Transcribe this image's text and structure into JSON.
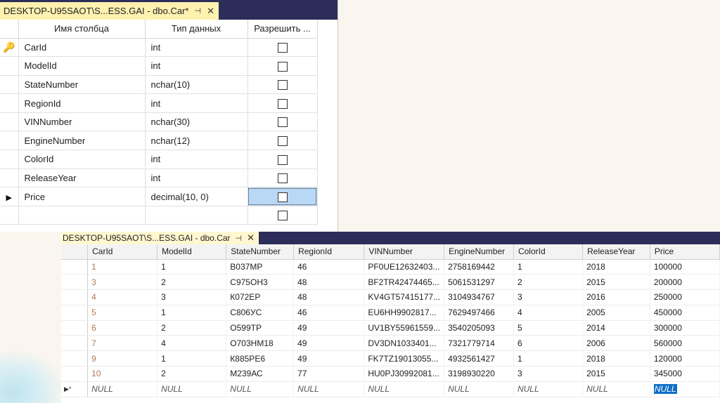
{
  "designer": {
    "tab_title": "DESKTOP-U95SAOT\\S...ESS.GAI - dbo.Car*",
    "pin_glyph": "⊣",
    "close_glyph": "✕",
    "columns": [
      "Имя столбца",
      "Тип данных",
      "Разрешить ..."
    ],
    "rows": [
      {
        "name": "CarId",
        "type": "int",
        "key": true
      },
      {
        "name": "ModelId",
        "type": "int"
      },
      {
        "name": "StateNumber",
        "type": "nchar(10)"
      },
      {
        "name": "RegionId",
        "type": "int"
      },
      {
        "name": "VINNumber",
        "type": "nchar(30)"
      },
      {
        "name": "EngineNumber",
        "type": "nchar(12)"
      },
      {
        "name": "ColorId",
        "type": "int"
      },
      {
        "name": "ReleaseYear",
        "type": "int"
      },
      {
        "name": "Price",
        "type": "decimal(10, 0)",
        "active": true
      },
      {
        "name": "",
        "type": ""
      }
    ]
  },
  "results": {
    "tab_title": "DESKTOP-U95SAOT\\S...ESS.GAI - dbo.Car",
    "pin_glyph": "⊣",
    "close_glyph": "✕",
    "columns": [
      "CarId",
      "ModelId",
      "StateNumber",
      "RegionId",
      "VINNumber",
      "EngineNumber",
      "ColorId",
      "ReleaseYear",
      "Price"
    ],
    "rows": [
      [
        "1",
        "1",
        "В037МР",
        "46",
        "PF0UE12632403...",
        "2758169442",
        "1",
        "2018",
        "100000"
      ],
      [
        "3",
        "2",
        "С975ОН3",
        "48",
        "BF2TR42474465...",
        "5061531297",
        "2",
        "2015",
        "200000"
      ],
      [
        "4",
        "3",
        "К072ЕР",
        "48",
        "KV4GT57415177...",
        "3104934767",
        "3",
        "2016",
        "250000"
      ],
      [
        "5",
        "1",
        "С806УС",
        "46",
        "EU6HH9902817...",
        "7629497466",
        "4",
        "2005",
        "450000"
      ],
      [
        "6",
        "2",
        "О599ТР",
        "49",
        "UV1BY55961559...",
        "3540205093",
        "5",
        "2014",
        "300000"
      ],
      [
        "7",
        "4",
        "О703НМ18",
        "49",
        "DV3DN1033401...",
        "7321779714",
        "6",
        "2006",
        "560000"
      ],
      [
        "9",
        "1",
        "К885РЕ6",
        "49",
        "FK7TZ19013055...",
        "4932561427",
        "1",
        "2018",
        "120000"
      ],
      [
        "10",
        "2",
        "М239АС",
        "77",
        "HU0PJ30992081...",
        "3198930220",
        "3",
        "2015",
        "345000"
      ]
    ],
    "new_row_marker": "▶*",
    "null_text": "NULL"
  }
}
